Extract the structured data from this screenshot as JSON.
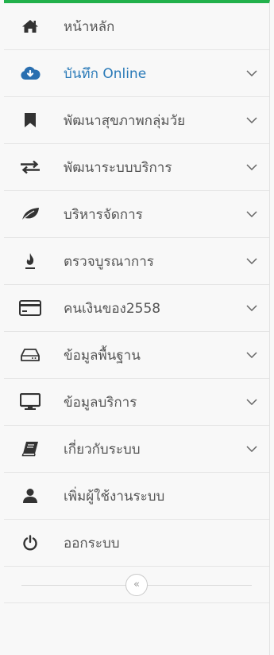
{
  "menu": {
    "items": [
      {
        "label": "หน้าหลัก",
        "icon": "home-icon",
        "has_submenu": false,
        "active": false
      },
      {
        "label": "บันทึก Online",
        "icon": "cloud-download-icon",
        "has_submenu": true,
        "active": true
      },
      {
        "label": "พัฒนาสุขภาพกลุ่มวัย",
        "icon": "bookmark-icon",
        "has_submenu": true,
        "active": false
      },
      {
        "label": "พัฒนาระบบบริการ",
        "icon": "exchange-arrows-icon",
        "has_submenu": true,
        "active": false
      },
      {
        "label": "บริหารจัดการ",
        "icon": "leaf-icon",
        "has_submenu": true,
        "active": false
      },
      {
        "label": "ตรวจบูรณาการ",
        "icon": "fire-icon",
        "has_submenu": true,
        "active": false
      },
      {
        "label": "คนเงินของ2558",
        "icon": "credit-card-icon",
        "has_submenu": true,
        "active": false
      },
      {
        "label": "ข้อมูลพื้นฐาน",
        "icon": "hdd-icon",
        "has_submenu": true,
        "active": false
      },
      {
        "label": "ข้อมูลบริการ",
        "icon": "desktop-icon",
        "has_submenu": true,
        "active": false
      },
      {
        "label": "เกี่ยวกับระบบ",
        "icon": "book-icon",
        "has_submenu": true,
        "active": false
      },
      {
        "label": "เพิ่มผู้ใช้งานระบบ",
        "icon": "user-icon",
        "has_submenu": false,
        "active": false
      },
      {
        "label": "ออกระบบ",
        "icon": "power-icon",
        "has_submenu": false,
        "active": false
      }
    ]
  },
  "collapse": {
    "symbol": "«"
  },
  "colors": {
    "accent_top_border": "#22b14c",
    "active_text": "#2a7ab8",
    "text": "#555555",
    "icon": "#333333"
  }
}
